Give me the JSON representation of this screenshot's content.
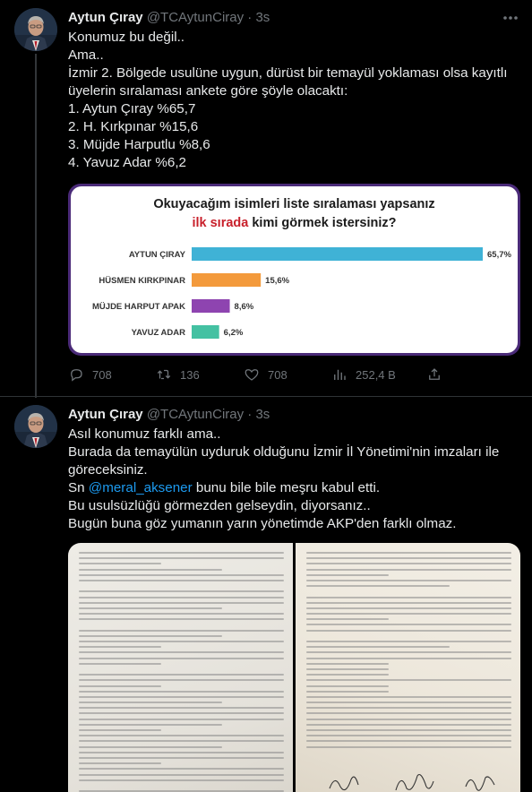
{
  "tweet1": {
    "author_name": "Aytun Çıray",
    "handle": "@TCAytunCiray",
    "time": "3s",
    "lines": [
      "Konumuz bu değil..",
      "Ama..",
      "İzmir 2. Bölgede usulüne uygun, dürüst bir temayül yoklaması olsa kayıtlı",
      "üyelerin sıralaması ankete göre şöyle olacaktı:",
      "1. Aytun Çıray %65,7",
      "2. H. Kırkpınar %15,6",
      "3. Müjde Harputlu %8,6",
      "4. Yavuz Adar %6,2"
    ],
    "actions": {
      "reply_count": "708",
      "retweet_count": "136",
      "like_count": "708",
      "view_count": "252,4 B"
    }
  },
  "tweet2": {
    "author_name": "Aytun Çıray",
    "handle": "@TCAytunCiray",
    "time": "3s",
    "line1": "Asıl konumuz farklı ama..",
    "line2": "Burada da temayülün uyduruk olduğunu İzmir İl Yönetimi'nin imzaları ile",
    "line3": "göreceksiniz.",
    "line4_prefix": "Sn ",
    "line4_mention": "@meral_aksener",
    "line4_suffix": " bunu bile bile meşru kabul etti.",
    "line5": "Bu usulsüzlüğü görmezden gelseydin, diyorsanız..",
    "line6": "Bugün buna göz yumanın yarın yönetimde AKP'den farklı olmaz."
  },
  "chart_data": {
    "type": "bar",
    "orientation": "horizontal",
    "title_line1": "Okuyacağım isimleri liste sıralaması yapsanız",
    "title_line2_highlight": "ilk sırada",
    "title_line2_rest": " kimi görmek istersiniz?",
    "categories": [
      "AYTUN ÇIRAY",
      "HÜSMEN KIRKPINAR",
      "MÜJDE HARPUT APAK",
      "YAVUZ ADAR"
    ],
    "values": [
      65.7,
      15.6,
      8.6,
      6.2
    ],
    "value_labels": [
      "65,7%",
      "15,6%",
      "8,6%",
      "6,2%"
    ],
    "colors": [
      "#3fb2d6",
      "#f39a3c",
      "#8e44b0",
      "#44c1a2"
    ],
    "xlim": [
      0,
      65.7
    ],
    "grid": false,
    "legend": "none"
  }
}
